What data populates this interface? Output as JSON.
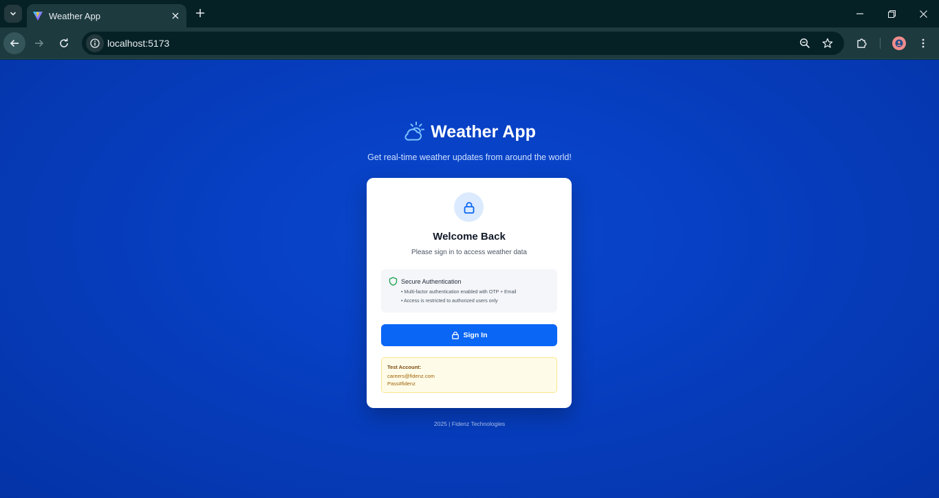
{
  "browser": {
    "tab_title": "Weather App",
    "url": "localhost:5173"
  },
  "app": {
    "title": "Weather App",
    "subtitle": "Get real-time weather updates from around the world!"
  },
  "card": {
    "title": "Welcome Back",
    "subtitle": "Please sign in to access weather data",
    "security": {
      "title": "Secure Authentication",
      "items": [
        "• Multi-factor authentication enabled with OTP + Email",
        "• Access is restricted to authorized users only"
      ]
    },
    "sign_in_label": "Sign In",
    "test_account": {
      "title": "Test Account:",
      "email": "careers@fidenz.com",
      "password": "Pass#fidenz"
    }
  },
  "footer": "2025 | Fidenz Technologies",
  "colors": {
    "primary": "#0a66f5",
    "background": "#0740c4",
    "shield": "#16a34a"
  }
}
